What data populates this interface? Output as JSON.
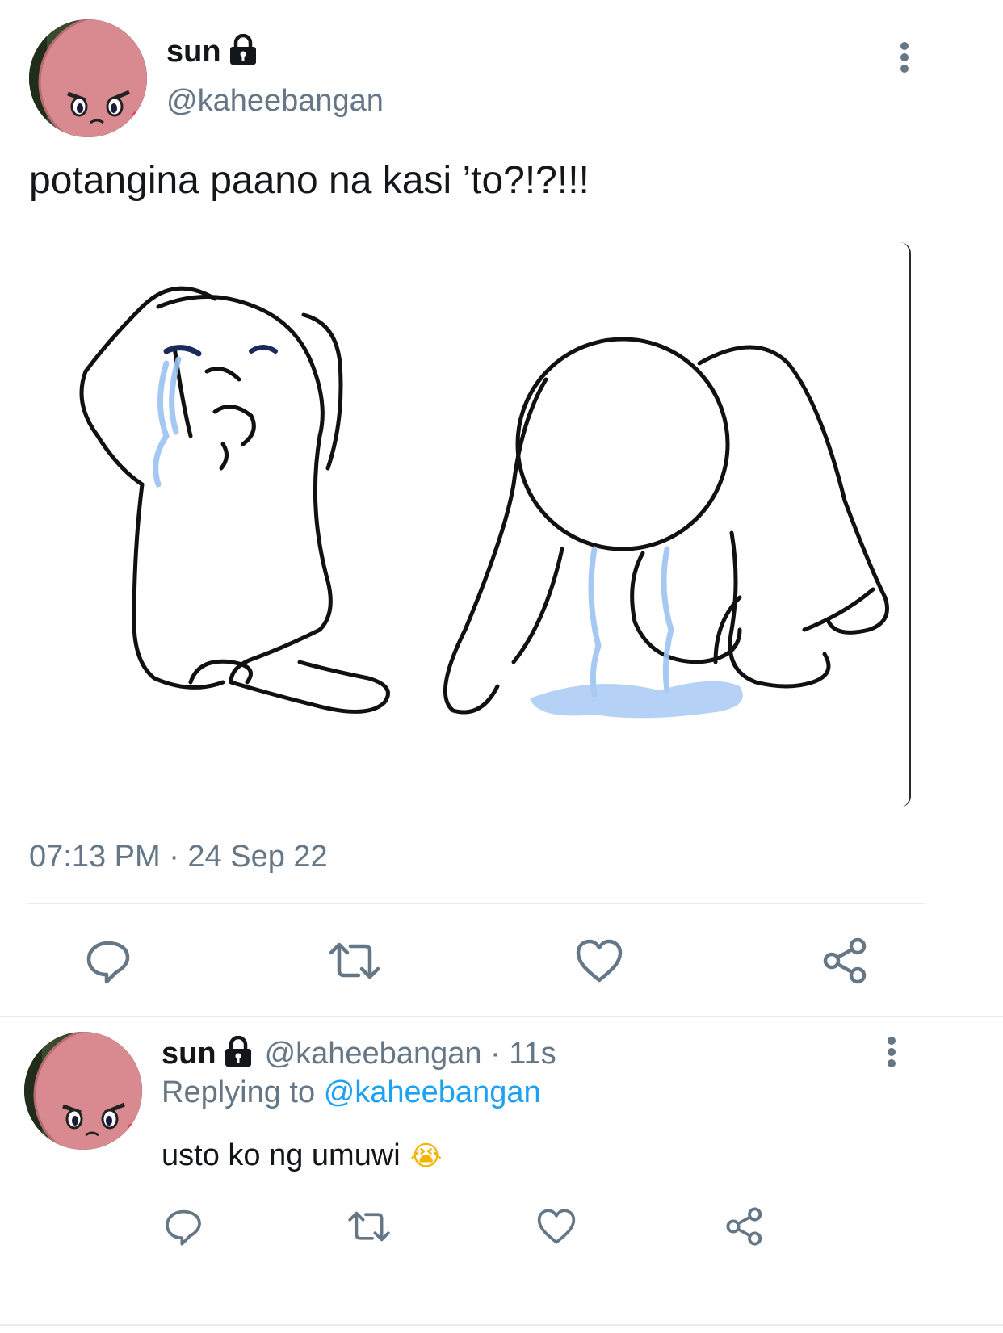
{
  "tweet": {
    "display_name": "sun",
    "handle": "@kaheebangan",
    "text": "potangina paano na kasi ’to?!?!!!",
    "timestamp": "07:13 PM · 24 Sep 22",
    "icons": [
      "more-vertical-icon",
      "lock-icon",
      "reply-icon",
      "retweet-icon",
      "like-icon",
      "share-icon"
    ]
  },
  "reply": {
    "display_name": "sun",
    "handle_time": "@kaheebangan · 11s",
    "replying_prefix": "Replying to",
    "replying_handle": "@kaheebangan",
    "text": "usto ko ng umuwi",
    "emoji": "😭"
  },
  "colors": {
    "text": "#14171a",
    "secondary": "#657786",
    "link": "#1da1f2",
    "divider": "#e6ecf0",
    "tears": "#9cc3f2"
  }
}
